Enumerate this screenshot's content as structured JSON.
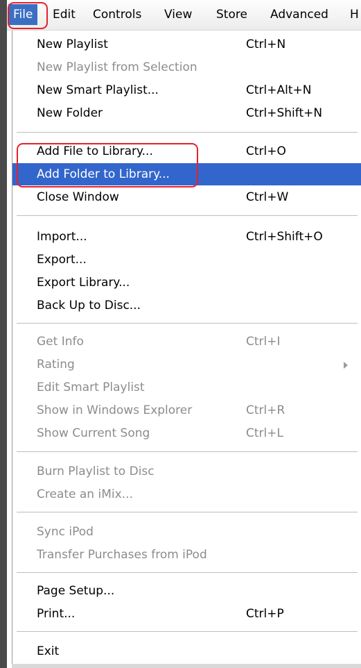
{
  "menubar": {
    "items": [
      "File",
      "Edit",
      "Controls",
      "View",
      "Store",
      "Advanced",
      "H"
    ]
  },
  "menu": {
    "items": [
      {
        "label": "New Playlist",
        "shortcut": "Ctrl+N"
      },
      {
        "label": "New Playlist from Selection",
        "shortcut": ""
      },
      {
        "label": "New Smart Playlist...",
        "shortcut": "Ctrl+Alt+N"
      },
      {
        "label": "New Folder",
        "shortcut": "Ctrl+Shift+N"
      },
      {
        "label": "Add File to Library...",
        "shortcut": "Ctrl+O"
      },
      {
        "label": "Add Folder to Library...",
        "shortcut": ""
      },
      {
        "label": "Close Window",
        "shortcut": "Ctrl+W"
      },
      {
        "label": "Import...",
        "shortcut": "Ctrl+Shift+O"
      },
      {
        "label": "Export...",
        "shortcut": ""
      },
      {
        "label": "Export Library...",
        "shortcut": ""
      },
      {
        "label": "Back Up to Disc...",
        "shortcut": ""
      },
      {
        "label": "Get Info",
        "shortcut": "Ctrl+I"
      },
      {
        "label": "Rating",
        "shortcut": ""
      },
      {
        "label": "Edit Smart Playlist",
        "shortcut": ""
      },
      {
        "label": "Show in Windows Explorer",
        "shortcut": "Ctrl+R"
      },
      {
        "label": "Show Current Song",
        "shortcut": "Ctrl+L"
      },
      {
        "label": "Burn Playlist to Disc",
        "shortcut": ""
      },
      {
        "label": "Create an iMix...",
        "shortcut": ""
      },
      {
        "label": "Sync iPod",
        "shortcut": ""
      },
      {
        "label": "Transfer Purchases from iPod",
        "shortcut": ""
      },
      {
        "label": "Page Setup...",
        "shortcut": ""
      },
      {
        "label": "Print...",
        "shortcut": "Ctrl+P"
      },
      {
        "label": "Exit",
        "shortcut": ""
      }
    ]
  },
  "colors": {
    "highlight": "#3366cc",
    "annotation": "#e8202a",
    "disabled_text": "#8c8c8c"
  }
}
